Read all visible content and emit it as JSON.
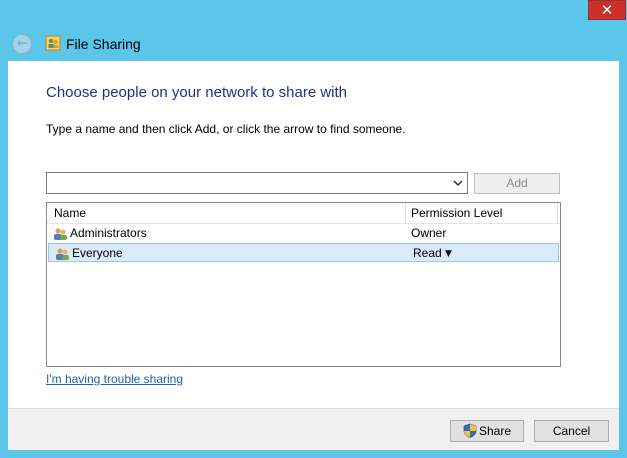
{
  "window": {
    "title": "File Sharing",
    "close_label": "✕"
  },
  "content": {
    "heading": "Choose people on your network to share with",
    "instruction": "Type a name and then click Add, or click the arrow to find someone.",
    "name_input": {
      "value": "",
      "placeholder": ""
    },
    "add_label": "Add"
  },
  "list": {
    "columns": [
      "Name",
      "Permission Level"
    ],
    "rows": [
      {
        "name": "Administrators",
        "permission": "Owner"
      },
      {
        "name": "Everyone",
        "permission": "Read"
      }
    ]
  },
  "trouble_link": "I'm having trouble sharing",
  "footer": {
    "share_label": "Share",
    "cancel_label": "Cancel"
  }
}
